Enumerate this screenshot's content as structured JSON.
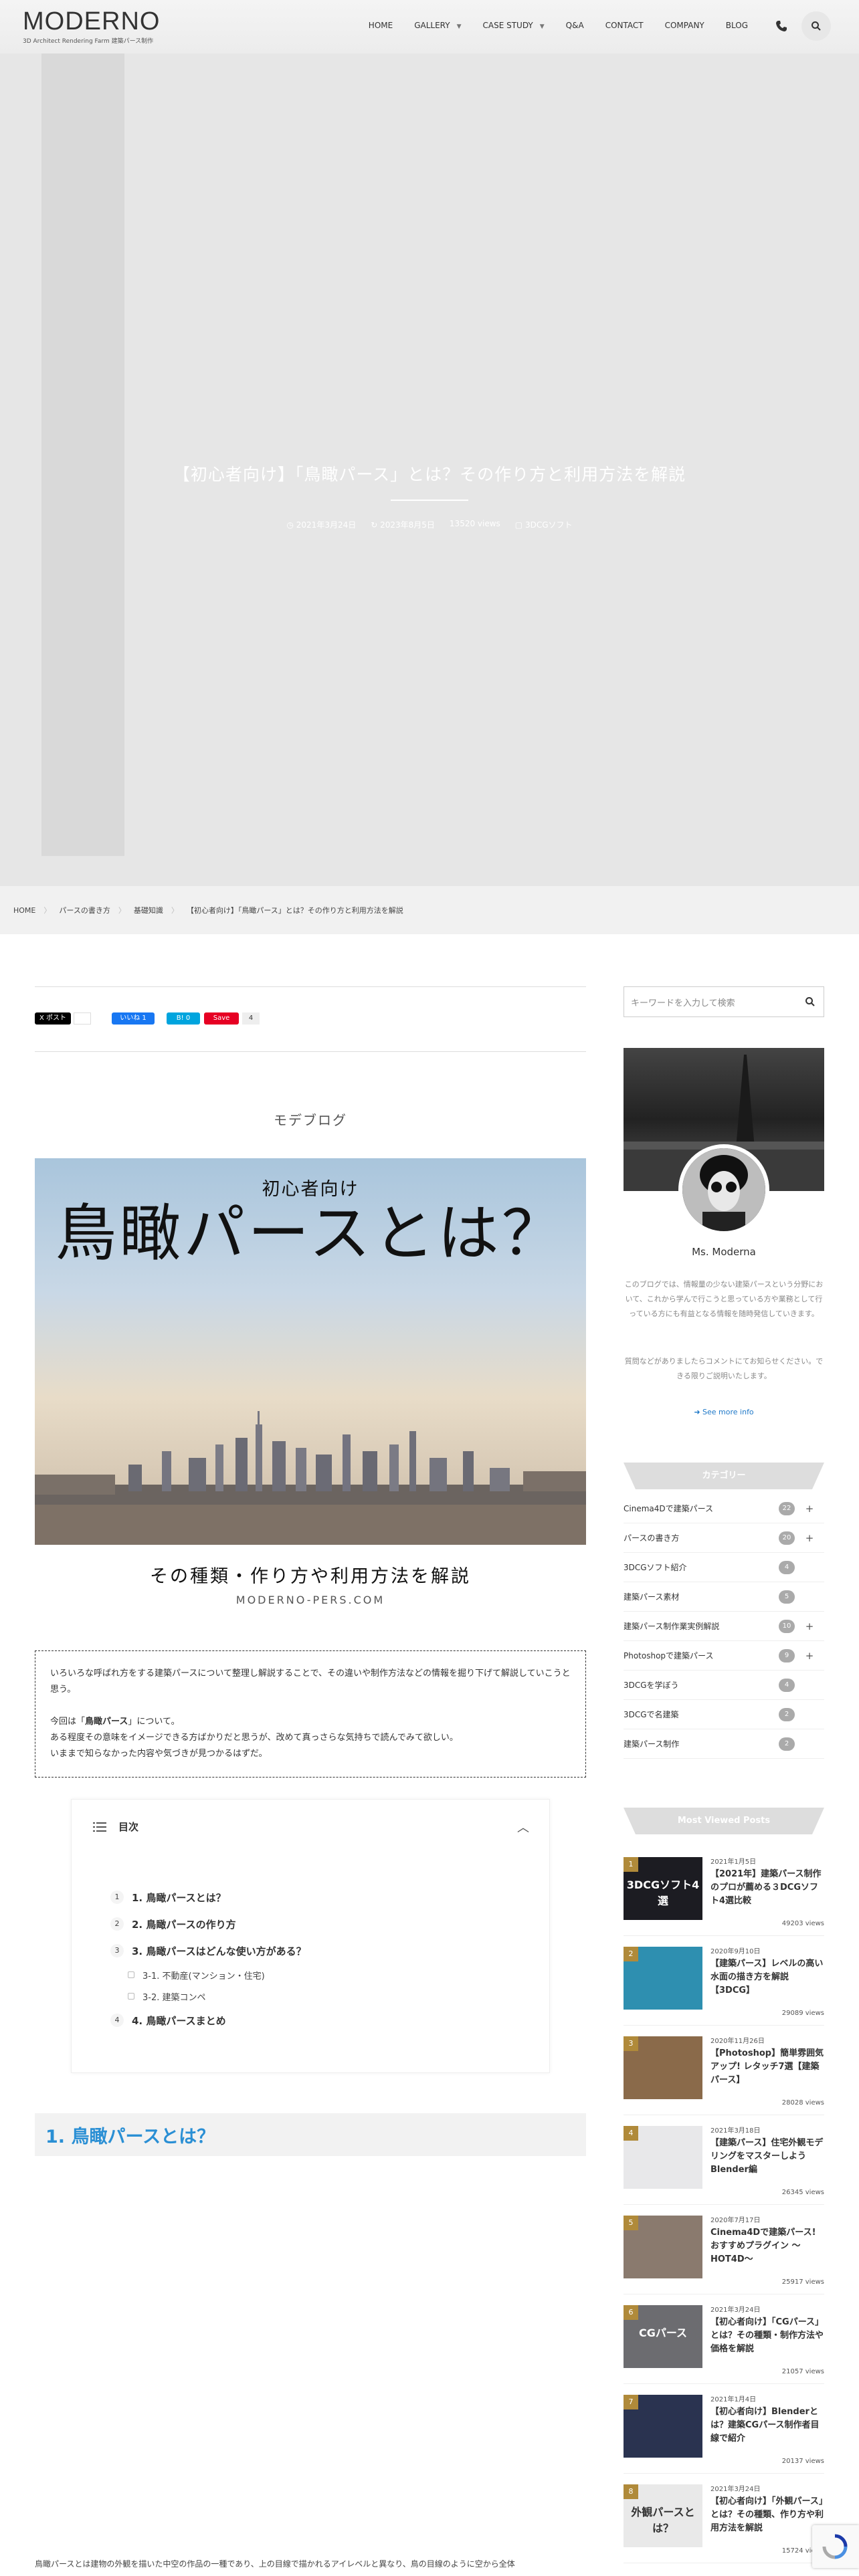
{
  "site": {
    "logo": "MODERNO",
    "tagline": "3D Architect Rendering Farm 建築パース制作"
  },
  "nav": {
    "items": [
      {
        "label": "HOME",
        "dropdown": false
      },
      {
        "label": "GALLERY",
        "dropdown": true
      },
      {
        "label": "CASE STUDY",
        "dropdown": true
      },
      {
        "label": "Q&A",
        "dropdown": false
      },
      {
        "label": "CONTACT",
        "dropdown": false
      },
      {
        "label": "COMPANY",
        "dropdown": false
      },
      {
        "label": "BLOG",
        "dropdown": false
      }
    ]
  },
  "hero": {
    "title": "【初心者向け】「鳥瞰パース」とは？その作り方と利用方法を解説",
    "published": "2021年3月24日",
    "updated": "2023年8月5日",
    "views": "13520 views",
    "category": "3DCGソフト"
  },
  "breadcrumb": [
    "HOME",
    "パースの書き方",
    "基礎知識",
    "【初心者向け】「鳥瞰パース」とは？その作り方と利用方法を解説"
  ],
  "share": {
    "x_label": "X ポスト",
    "x_count": "",
    "fb_label": "いいね 1",
    "hatena_label": "B! 0",
    "pin_label": "Save",
    "pin_count": "4"
  },
  "article": {
    "blog_label": "モデブログ",
    "eyecatch_small": "初心者向け",
    "eyecatch_big": "鳥瞰パースとは？",
    "eyecatch_sub": "その種類・作り方や利用方法を解説",
    "eyecatch_domain": "MODERNO-PERS.COM",
    "intro_1": "いろいろな呼ばれ方をする建築パースについて整理し解説することで、その違いや制作方法などの情報を掘り下げて解説していこうと思う。",
    "intro_2a": "今回は「",
    "intro_2b": "鳥瞰パース",
    "intro_2c": "」について。",
    "intro_3": "ある程度その意味をイメージできる方ばかりだと思うが、改めて真っさらな気持ちで読んでみて欲しい。",
    "intro_4": "いままで知らなかった内容や気づきが見つかるはずだ。",
    "toc_title": "目次",
    "toc": [
      {
        "num": "1",
        "label": "1. 鳥瞰パースとは？",
        "subs": []
      },
      {
        "num": "2",
        "label": "2. 鳥瞰パースの作り方",
        "subs": []
      },
      {
        "num": "3",
        "label": "3. 鳥瞰パースはどんな使い方がある？",
        "subs": [
          "3-1. 不動産(マンション・住宅)",
          "3-2. 建築コンペ"
        ]
      },
      {
        "num": "4",
        "label": "4. 鳥瞰パースまとめ",
        "subs": []
      }
    ],
    "h2_1": "1. 鳥瞰パースとは？",
    "body_1": "鳥瞰パースとは建物の外観を描いた中空の作品の一種であり、上の目線で描かれるアイレベルと異なり、鳥の目線のように空から全体"
  },
  "sidebar": {
    "search_placeholder": "キーワードを入力して検索",
    "profile_name": "Ms. Moderna",
    "profile_desc": "このブログでは、情報量の少ない建築パースという分野において、これから学んで行こうと思っている方や業務として行っている方にも有益となる情報を随時発信していきます。",
    "profile_desc2": "質問などがありましたらコメントにてお知らせください。できる限りご説明いたします。",
    "see_more": "See more info",
    "category_title": "カテゴリー",
    "categories": [
      {
        "label": "Cinema4Dで建築パース",
        "count": "22",
        "expand": true
      },
      {
        "label": "パースの書き方",
        "count": "20",
        "expand": true
      },
      {
        "label": "3DCGソフト紹介",
        "count": "4",
        "expand": false
      },
      {
        "label": "建築パース素材",
        "count": "5",
        "expand": false
      },
      {
        "label": "建築パース制作業実例解説",
        "count": "10",
        "expand": true
      },
      {
        "label": "Photoshopで建築パース",
        "count": "9",
        "expand": true
      },
      {
        "label": "3DCGを学ぼう",
        "count": "4",
        "expand": false
      },
      {
        "label": "3DCGで名建築",
        "count": "2",
        "expand": false
      },
      {
        "label": "建築パース制作",
        "count": "2",
        "expand": false
      }
    ],
    "popular_title": "Most Viewed Posts",
    "popular": [
      {
        "rank": "1",
        "date": "2021年1月5日",
        "title": "【2021年】建築パース制作のプロが薦める３DCGソフト4選比較",
        "views": "49203 views",
        "thumb": "#1c1c22",
        "thumb_text": "3DCGソフト4選"
      },
      {
        "rank": "2",
        "date": "2020年9月10日",
        "title": "【建築パース】レベルの高い水面の描き方を解説【3DCG】",
        "views": "29089 views",
        "thumb": "#2e8fb0",
        "thumb_text": ""
      },
      {
        "rank": "3",
        "date": "2020年11月26日",
        "title": "【Photoshop】簡単雰囲気アップ! レタッチ7選【建築パース】",
        "views": "28028 views",
        "thumb": "#8a6a4a",
        "thumb_text": ""
      },
      {
        "rank": "4",
        "date": "2021年3月18日",
        "title": "【建築パース】住宅外観モデリングをマスターしようBlender編",
        "views": "26345 views",
        "thumb": "#e8e8ea",
        "thumb_text": ""
      },
      {
        "rank": "5",
        "date": "2020年7月17日",
        "title": "Cinema4Dで建築パース! おすすめプラグイン 〜HOT4D〜",
        "views": "25917 views",
        "thumb": "#8a7a6e",
        "thumb_text": ""
      },
      {
        "rank": "6",
        "date": "2021年3月24日",
        "title": "【初心者向け】「CGパース」とは？その種類・制作方法や価格を解説",
        "views": "21057 views",
        "thumb": "#6c6c70",
        "thumb_text": "CGパース"
      },
      {
        "rank": "7",
        "date": "2021年1月4日",
        "title": "【初心者向け】Blenderとは？建築CGパース制作者目線で紹介",
        "views": "20137 views",
        "thumb": "#2a3350",
        "thumb_text": ""
      },
      {
        "rank": "8",
        "date": "2021年3月24日",
        "title": "【初心者向け】「外観パース」とは？その種類、作り方や利用方法を解説",
        "views": "15724 views",
        "thumb": "#e9e9e9",
        "thumb_text": "外観パースとは？"
      }
    ]
  }
}
